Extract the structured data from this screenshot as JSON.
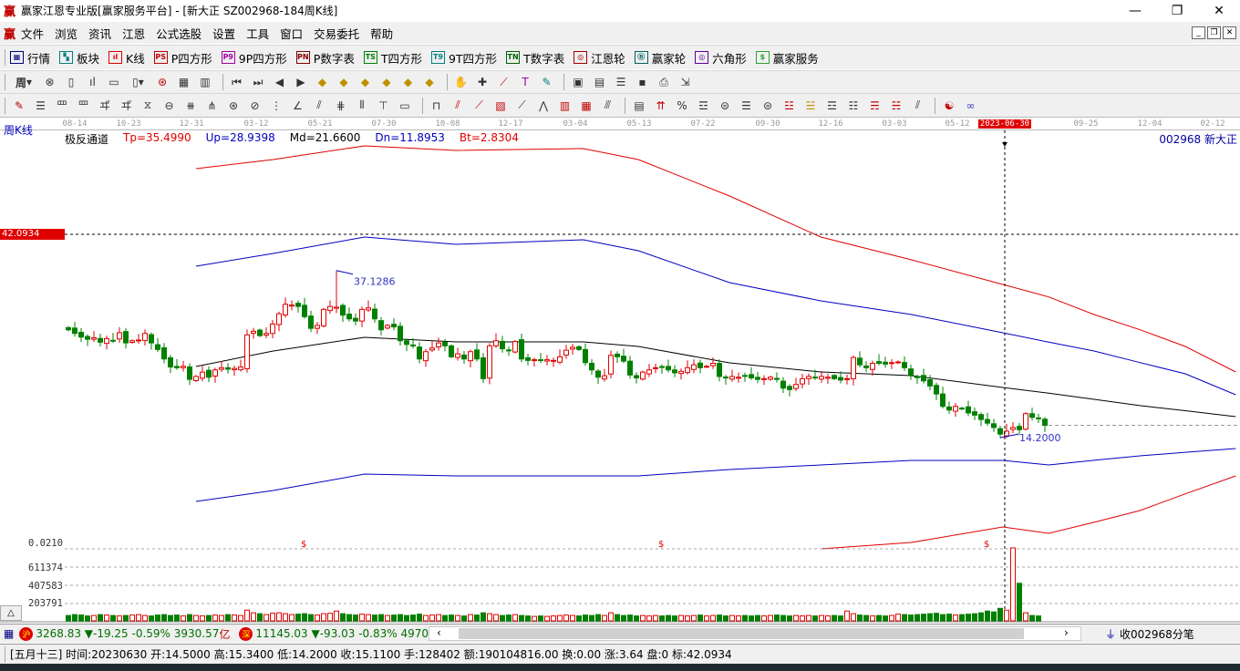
{
  "window": {
    "title": "赢家江恩专业版[赢家服务平台] - [新大正   SZ002968-184周K线]",
    "logo": "赢",
    "minimize": "—",
    "maximize": "❐",
    "close": "✕"
  },
  "menu": {
    "logo": "赢",
    "items": [
      "文件",
      "浏览",
      "资讯",
      "江恩",
      "公式选股",
      "设置",
      "工具",
      "窗口",
      "交易委托",
      "帮助"
    ],
    "mdi": [
      "_",
      "❐",
      "✕"
    ]
  },
  "toolbar": [
    {
      "icon": "▦",
      "label": "行情",
      "color": "#000080"
    },
    {
      "icon": "▚",
      "label": "板块",
      "color": "#008080"
    },
    {
      "icon": "ıl",
      "label": "K线",
      "color": "#e00000"
    },
    {
      "icon": "PS",
      "label": "P四方形",
      "color": "#c00000"
    },
    {
      "icon": "P9",
      "label": "9P四方形",
      "color": "#a000a0"
    },
    {
      "icon": "PN",
      "label": "P数字表",
      "color": "#800000"
    },
    {
      "icon": "TS",
      "label": "T四方形",
      "color": "#008000"
    },
    {
      "icon": "T9",
      "label": "9T四方形",
      "color": "#008080"
    },
    {
      "icon": "TN",
      "label": "T数字表",
      "color": "#006000"
    },
    {
      "icon": "◎",
      "label": "江恩轮",
      "color": "#a00000"
    },
    {
      "icon": "Ⓑ",
      "label": "赢家轮",
      "color": "#006060"
    },
    {
      "icon": "◎",
      "label": "六角形",
      "color": "#6000a0"
    },
    {
      "icon": "$",
      "label": "赢家服务",
      "color": "#30a030"
    }
  ],
  "period_button": "周",
  "axis": {
    "dates": [
      "08-14",
      "10-23",
      "12-31",
      "03-12",
      "05-21",
      "07-30",
      "10-08",
      "12-17",
      "03-04",
      "05-13",
      "07-22",
      "09-30",
      "12-16",
      "03-03",
      "05-12",
      "2023-06-30",
      "09-25",
      "12-04",
      "02-12"
    ],
    "highlight_index": 15
  },
  "chart_title": "周K线",
  "indicator": {
    "name": "极反通道",
    "tp": "Tp=35.4990",
    "up": "Up=28.9398",
    "md": "Md=21.6600",
    "dn": "Dn=11.8953",
    "bt": "Bt=2.8304"
  },
  "stock": "002968  新大正",
  "price_tag": "42.0934",
  "colors": {
    "up": "#e00000",
    "down": "#008000",
    "tp": "#e00000",
    "upband": "#0000c0",
    "md": "#000000",
    "dn": "#0000c0",
    "bt": "#e00000"
  },
  "chart_data": {
    "type": "candlestick",
    "period": "weekly",
    "high_label": "37.1286",
    "low_label": "14.2000",
    "high_index": 42,
    "low_index": 146,
    "high_value": 37.1286,
    "low_value": 14.2,
    "crosshair_index": 146,
    "closes": [
      29.0,
      28.5,
      28.0,
      27.7,
      27.9,
      27.3,
      27.8,
      27.5,
      28.6,
      27.2,
      27.5,
      27.6,
      28.5,
      27.2,
      26.3,
      25.0,
      23.9,
      23.8,
      24.0,
      22.2,
      22.6,
      23.2,
      22.5,
      23.5,
      23.8,
      23.6,
      23.7,
      23.9,
      28.3,
      28.8,
      28.2,
      28.5,
      29.8,
      31.2,
      32.5,
      32.4,
      32.2,
      30.8,
      29.2,
      29.6,
      31.8,
      32.2,
      32.1,
      31.0,
      30.5,
      30.2,
      31.8,
      32.0,
      30.5,
      29.0,
      29.6,
      29.4,
      27.5,
      27.0,
      26.8,
      25.0,
      26.0,
      26.5,
      27.2,
      26.8,
      25.3,
      25.7,
      25.0,
      26.0,
      25.0,
      22.3,
      26.8,
      27.5,
      26.4,
      26.2,
      27.4,
      25.0,
      24.8,
      24.9,
      24.8,
      24.9,
      24.8,
      25.3,
      26.2,
      26.6,
      26.3,
      24.5,
      23.5,
      22.5,
      22.7,
      25.5,
      25.3,
      24.7,
      22.8,
      22.4,
      23.2,
      23.5,
      23.8,
      23.9,
      23.5,
      23.1,
      23.3,
      23.8,
      24.2,
      23.8,
      24.0,
      24.4,
      22.6,
      22.4,
      22.6,
      22.5,
      22.7,
      22.4,
      22.2,
      22.3,
      22.5,
      22.2,
      21.0,
      20.8,
      21.5,
      22.3,
      22.6,
      22.4,
      22.6,
      22.5,
      22.3,
      22.1,
      22.3,
      25.2,
      24.2,
      23.8,
      24.4,
      24.4,
      24.3,
      24.5,
      24.6,
      23.8,
      22.8,
      22.5,
      22.0,
      21.3,
      20.2,
      18.5,
      18.0,
      18.5,
      18.2,
      17.6,
      17.3,
      16.7,
      16.2,
      15.6,
      14.7,
      15.1,
      15.6,
      15.3,
      17.5,
      17.0,
      16.9,
      15.9
    ],
    "bands": {
      "index": [
        20,
        32.1,
        46.4,
        60.7,
        80.7,
        89.3,
        103.6,
        117.9,
        132.1,
        146.4,
        153.6,
        160.7,
        167.9,
        175,
        182.9
      ],
      "tp": [
        51.09,
        52.34,
        54.22,
        53.59,
        53.84,
        52.34,
        47.34,
        41.72,
        38.59,
        35.22,
        33.5,
        31.09,
        29.0,
        26.72,
        23.22
      ],
      "up": [
        37.72,
        39.47,
        41.72,
        40.72,
        41.34,
        39.84,
        35.47,
        32.97,
        31.09,
        28.59,
        27.3,
        26.09,
        24.5,
        22.97,
        20.09
      ],
      "md": [
        23.97,
        26.09,
        27.97,
        27.34,
        27.34,
        26.72,
        24.47,
        23.22,
        22.72,
        21.09,
        20.3,
        19.47,
        18.6,
        17.9,
        17.09
      ],
      "dn": [
        5.47,
        6.97,
        9.22,
        8.97,
        8.97,
        8.97,
        9.84,
        10.47,
        11.09,
        11.09,
        10.47,
        11.1,
        11.72,
        12.2,
        12.72
      ],
      "bt": [
        null,
        null,
        null,
        null,
        null,
        null,
        null,
        -1.03,
        -0.16,
        1.97,
        1.09,
        2.6,
        4.22,
        6.5,
        8.97
      ]
    },
    "volume": {
      "ticks": [
        "0.0210",
        "611374",
        "407583",
        "203791"
      ],
      "tick_values": [
        815000,
        611374,
        407583,
        203791
      ],
      "values": [
        60000,
        70000,
        65000,
        55000,
        60000,
        70000,
        65000,
        60000,
        55000,
        60000,
        65000,
        70000,
        60000,
        55000,
        65000,
        70000,
        60000,
        65000,
        55000,
        70000,
        60000,
        55000,
        60000,
        65000,
        60000,
        70000,
        65000,
        60000,
        120000,
        90000,
        80000,
        70000,
        85000,
        90000,
        80000,
        70000,
        75000,
        80000,
        70000,
        65000,
        80000,
        85000,
        110000,
        80000,
        70000,
        65000,
        75000,
        70000,
        65000,
        70000,
        60000,
        65000,
        70000,
        60000,
        65000,
        75000,
        60000,
        65000,
        70000,
        60000,
        65000,
        60000,
        55000,
        70000,
        65000,
        90000,
        80000,
        70000,
        60000,
        65000,
        70000,
        60000,
        55000,
        50000,
        55000,
        50000,
        55000,
        60000,
        65000,
        60000,
        55000,
        65000,
        60000,
        70000,
        60000,
        90000,
        70000,
        60000,
        65000,
        55000,
        60000,
        55000,
        60000,
        55000,
        60000,
        55000,
        60000,
        55000,
        60000,
        65000,
        55000,
        60000,
        65000,
        55000,
        60000,
        55000,
        60000,
        55000,
        60000,
        55000,
        60000,
        65000,
        60000,
        55000,
        60000,
        55000,
        60000,
        55000,
        60000,
        55000,
        60000,
        55000,
        110000,
        80000,
        65000,
        60000,
        55000,
        60000,
        55000,
        60000,
        75000,
        70000,
        65000,
        70000,
        75000,
        80000,
        85000,
        70000,
        75000,
        65000,
        70000,
        75000,
        80000,
        90000,
        110000,
        100000,
        140000,
        120000,
        815000,
        420000,
        90000,
        60000,
        55000
      ]
    },
    "dividend_markers": {
      "label": "$",
      "indices": [
        37,
        93,
        144
      ]
    }
  },
  "status": {
    "sh_badge": "沪",
    "sh": "3268.83 ▼-19.25 -0.59% 3930.57",
    "sh_unit": "亿",
    "sz_badge": "深",
    "sz": "11145.03 ▼-93.03 -0.83% 4970.20",
    "scroll_left": "‹",
    "scroll_right": "›",
    "tick": "收002968分笔"
  },
  "info": "[五月十三] 时间:20230630 开:14.5000 高:15.3400 低:14.2000 收:15.1100 手:128402 额:190104816.00 换:0.00 涨:3.64 盘:0 标:42.0934"
}
